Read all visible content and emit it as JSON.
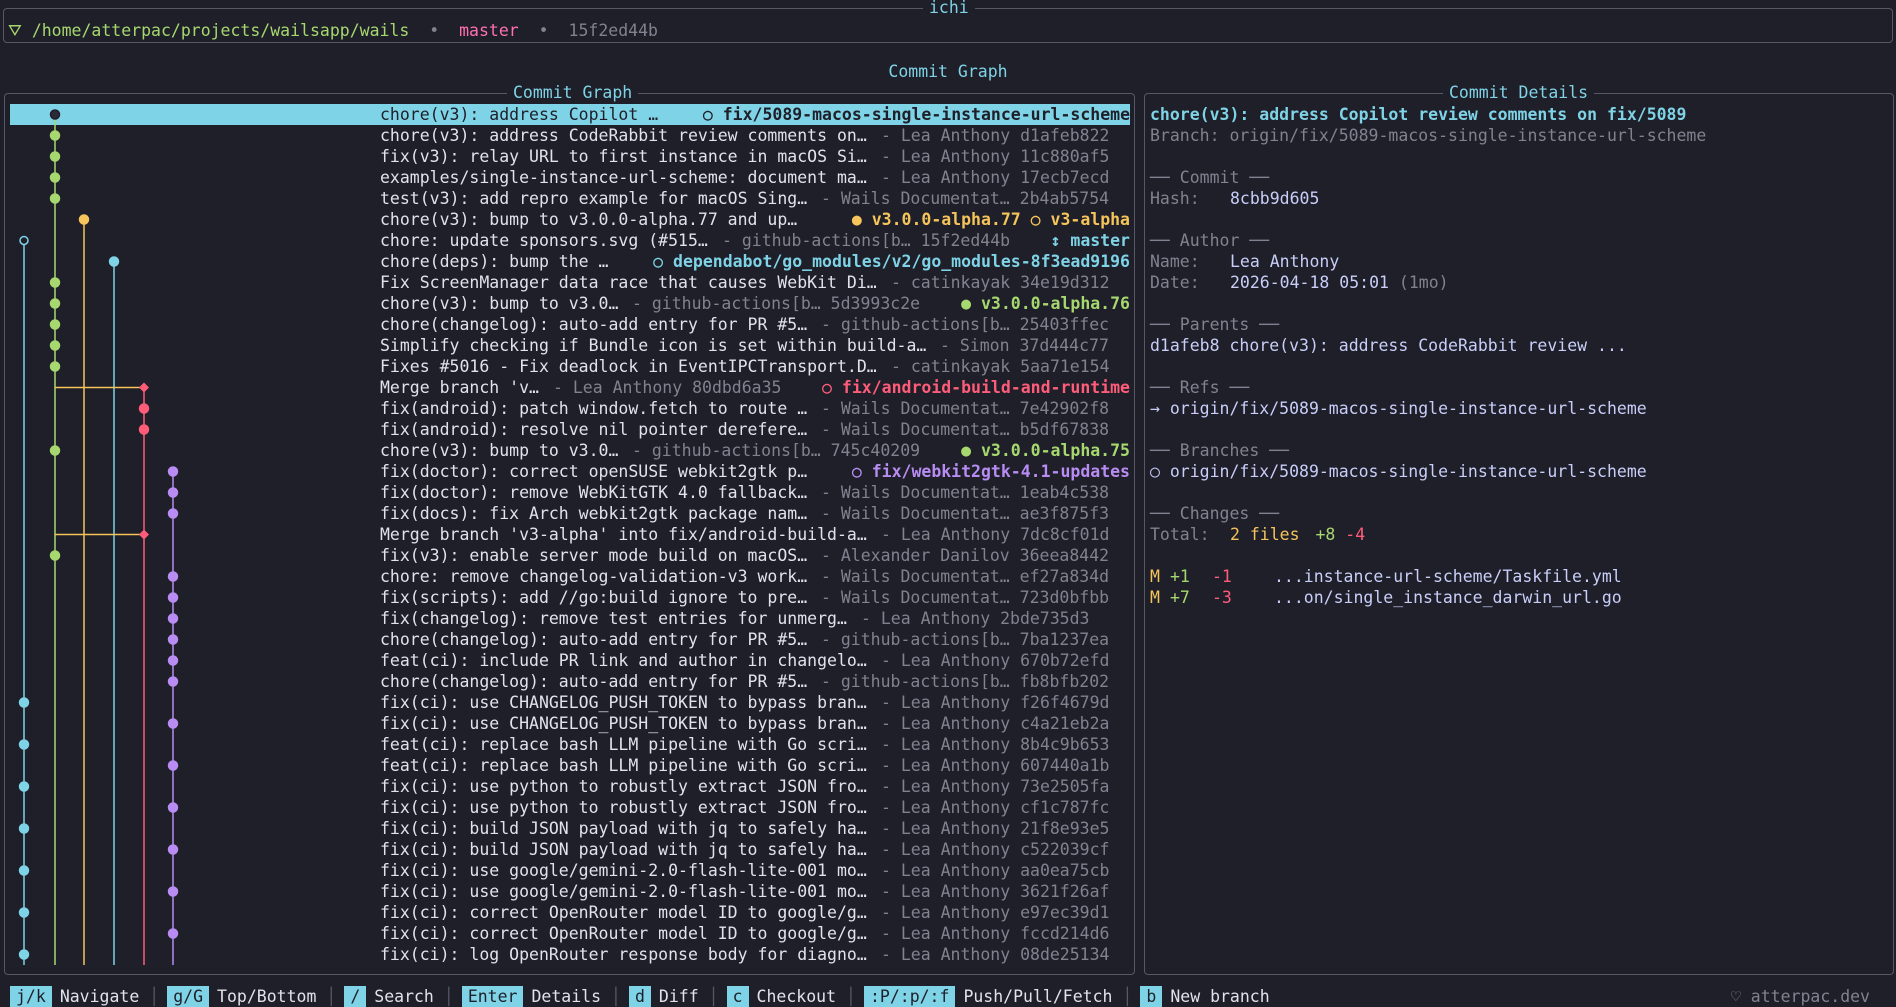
{
  "app_title": "ichi",
  "header": {
    "path": "/home/atterpac/projects/wailsapp/wails",
    "branch": "master",
    "hash": "15f2ed44b",
    "dot": "•"
  },
  "view_title": "Commit Graph",
  "list_panel_title": "Commit Graph",
  "details_panel_title": "Commit Details",
  "commits": [
    {
      "msg": "chore(v3): address Copilot …",
      "meta": "",
      "ref": "○ fix/5089-macos-single-instance-url-scheme",
      "ref_color": "#1e1f29",
      "selected": true
    },
    {
      "msg": "chore(v3): address CodeRabbit review comments on…",
      "meta": "- Lea Anthony d1afeb822",
      "ref": ""
    },
    {
      "msg": "fix(v3): relay URL to first instance in macOS Si…",
      "meta": "- Lea Anthony 11c880af5",
      "ref": ""
    },
    {
      "msg": "examples/single-instance-url-scheme: document ma…",
      "meta": "- Lea Anthony 17ecb7ecd",
      "ref": ""
    },
    {
      "msg": "test(v3): add repro example for macOS Sing…",
      "meta": "- Wails Documentat… 2b4ab5754",
      "ref": ""
    },
    {
      "msg": "chore(v3): bump to v3.0.0-alpha.77 and up…",
      "meta": "",
      "ref": "● v3.0.0-alpha.77  ○ v3-alpha",
      "ref_color": "#f5c45b"
    },
    {
      "msg": "chore: update sponsors.svg (#515…",
      "meta": "- github-actions[b… 15f2ed44b",
      "ref": "↕ master",
      "ref_color": "#7fd3e6"
    },
    {
      "msg": "chore(deps): bump the …",
      "meta": "",
      "ref": "○ dependabot/go_modules/v2/go_modules-8f3ead9196",
      "ref_color": "#7fd3e6"
    },
    {
      "msg": "Fix ScreenManager data race that causes WebKit Di…",
      "meta": "- catinkayak 34e19d312",
      "ref": ""
    },
    {
      "msg": "chore(v3): bump to v3.0…",
      "meta": "- github-actions[b… 5d3993c2e",
      "ref": "● v3.0.0-alpha.76",
      "ref_color": "#a6d86f"
    },
    {
      "msg": "chore(changelog): auto-add entry for PR #5…",
      "meta": "- github-actions[b… 25403ffec",
      "ref": ""
    },
    {
      "msg": "Simplify checking if Bundle icon is set within build-a…",
      "meta": "- Simon 37d444c77",
      "ref": ""
    },
    {
      "msg": "Fixes #5016 - Fix deadlock in EventIPCTransport.D…",
      "meta": "- catinkayak 5aa71e154",
      "ref": ""
    },
    {
      "msg": "Merge branch 'v…",
      "meta": "- Lea Anthony 80dbd6a35",
      "ref": "○ fix/android-build-and-runtime",
      "ref_color": "#ff5c7a"
    },
    {
      "msg": "fix(android): patch window.fetch to route …",
      "meta": "- Wails Documentat… 7e42902f8",
      "ref": ""
    },
    {
      "msg": "fix(android): resolve nil pointer derefere…",
      "meta": "- Wails Documentat… b5df67838",
      "ref": ""
    },
    {
      "msg": "chore(v3): bump to v3.0…",
      "meta": "- github-actions[b… 745c40209",
      "ref": "● v3.0.0-alpha.75",
      "ref_color": "#a6d86f"
    },
    {
      "msg": "fix(doctor): correct openSUSE webkit2gtk p…",
      "meta": "",
      "ref": "○ fix/webkit2gtk-4.1-updates",
      "ref_color": "#b98cf3"
    },
    {
      "msg": "fix(doctor): remove WebKitGTK 4.0 fallback…",
      "meta": "- Wails Documentat… 1eab4c538",
      "ref": ""
    },
    {
      "msg": "fix(docs): fix Arch webkit2gtk package nam…",
      "meta": "- Wails Documentat… ae3f875f3",
      "ref": ""
    },
    {
      "msg": "Merge branch 'v3-alpha' into fix/android-build-a…",
      "meta": "- Lea Anthony 7dc8cf01d",
      "ref": ""
    },
    {
      "msg": "fix(v3): enable server mode build on macOS…",
      "meta": "- Alexander Danilov 36eea8442",
      "ref": ""
    },
    {
      "msg": "chore: remove changelog-validation-v3 work…",
      "meta": "- Wails Documentat… ef27a834d",
      "ref": ""
    },
    {
      "msg": "fix(scripts): add //go:build ignore to pre…",
      "meta": "- Wails Documentat… 723d0bfbb",
      "ref": ""
    },
    {
      "msg": "fix(changelog): remove test entries for unmerg…",
      "meta": "- Lea Anthony 2bde735d3",
      "ref": ""
    },
    {
      "msg": "chore(changelog): auto-add entry for PR #5…",
      "meta": "- github-actions[b… 7ba1237ea",
      "ref": ""
    },
    {
      "msg": "feat(ci): include PR link and author in changelo…",
      "meta": "- Lea Anthony 670b72efd",
      "ref": ""
    },
    {
      "msg": "chore(changelog): auto-add entry for PR #5…",
      "meta": "- github-actions[b… fb8bfb202",
      "ref": ""
    },
    {
      "msg": "fix(ci): use CHANGELOG_PUSH_TOKEN to bypass bran…",
      "meta": "- Lea Anthony f26f4679d",
      "ref": ""
    },
    {
      "msg": "fix(ci): use CHANGELOG_PUSH_TOKEN to bypass bran…",
      "meta": "- Lea Anthony c4a21eb2a",
      "ref": ""
    },
    {
      "msg": "feat(ci): replace bash LLM pipeline with Go scri…",
      "meta": "- Lea Anthony 8b4c9b653",
      "ref": ""
    },
    {
      "msg": "feat(ci): replace bash LLM pipeline with Go scri…",
      "meta": "- Lea Anthony 607440a1b",
      "ref": ""
    },
    {
      "msg": "fix(ci): use python to robustly extract JSON fro…",
      "meta": "- Lea Anthony 73e2505fa",
      "ref": ""
    },
    {
      "msg": "fix(ci): use python to robustly extract JSON fro…",
      "meta": "- Lea Anthony cf1c787fc",
      "ref": ""
    },
    {
      "msg": "fix(ci): build JSON payload with jq to safely ha…",
      "meta": "- Lea Anthony 21f8e93e5",
      "ref": ""
    },
    {
      "msg": "fix(ci): build JSON payload with jq to safely ha…",
      "meta": "- Lea Anthony c522039cf",
      "ref": ""
    },
    {
      "msg": "fix(ci): use google/gemini-2.0-flash-lite-001 mo…",
      "meta": "- Lea Anthony aa0ea75cb",
      "ref": ""
    },
    {
      "msg": "fix(ci): use google/gemini-2.0-flash-lite-001 mo…",
      "meta": "- Lea Anthony 3621f26af",
      "ref": ""
    },
    {
      "msg": "fix(ci): correct OpenRouter model ID to google/g…",
      "meta": "- Lea Anthony e97ec39d1",
      "ref": ""
    },
    {
      "msg": "fix(ci): correct OpenRouter model ID to google/g…",
      "meta": "- Lea Anthony fccd214d6",
      "ref": ""
    },
    {
      "msg": "fix(ci): log OpenRouter response body for diagno…",
      "meta": "- Lea Anthony 08de25134",
      "ref": ""
    }
  ],
  "details": {
    "subject": "chore(v3): address Copilot review comments on fix/5089",
    "branch_line": "Branch: origin/fix/5089-macos-single-instance-url-scheme",
    "commit_header": "── Commit ──",
    "hash_label": "Hash:",
    "hash_value": "8cbb9d605",
    "author_header": "── Author ──",
    "name_label": "Name:",
    "name_value": "Lea Anthony",
    "date_label": "Date:",
    "date_value": "2026-04-18 05:01",
    "date_relative": "(1mo)",
    "parents_header": "── Parents ──",
    "parent_hash": "d1afeb8",
    "parent_msg": "chore(v3): address CodeRabbit review  ...",
    "refs_header": "── Refs ──",
    "ref_value": "→ origin/fix/5089-macos-single-instance-url-scheme",
    "branches_header": "── Branches ──",
    "branch_value": "○ origin/fix/5089-macos-single-instance-url-scheme",
    "changes_header": "── Changes ──",
    "total_label": "Total:",
    "total_files": "2 files",
    "total_add": "+8",
    "total_del": "-4",
    "files": [
      {
        "status": "M",
        "add": "+1",
        "del": "-1",
        "path": "...instance-url-scheme/Taskfile.yml"
      },
      {
        "status": "M",
        "add": "+7",
        "del": "-3",
        "path": "...on/single_instance_darwin_url.go"
      }
    ]
  },
  "footer": {
    "items": [
      {
        "key": "j/k",
        "label": "Navigate"
      },
      {
        "key": "g/G",
        "label": "Top/Bottom"
      },
      {
        "key": "/",
        "label": "Search"
      },
      {
        "key": "Enter",
        "label": "Details"
      },
      {
        "key": "d",
        "label": "Diff"
      },
      {
        "key": "c",
        "label": "Checkout"
      },
      {
        "key": ":P/:p/:f",
        "label": "Push/Pull/Fetch"
      },
      {
        "key": "b",
        "label": "New branch"
      }
    ],
    "credit": "♡ atterpac.dev"
  },
  "colors": {
    "background": "#1e1f29",
    "accent_cyan": "#7fd3e6",
    "green": "#a6d86f",
    "yellow": "#f5c45b",
    "red": "#ff5c7a",
    "purple": "#b98cf3",
    "pink": "#ff6fb1"
  }
}
